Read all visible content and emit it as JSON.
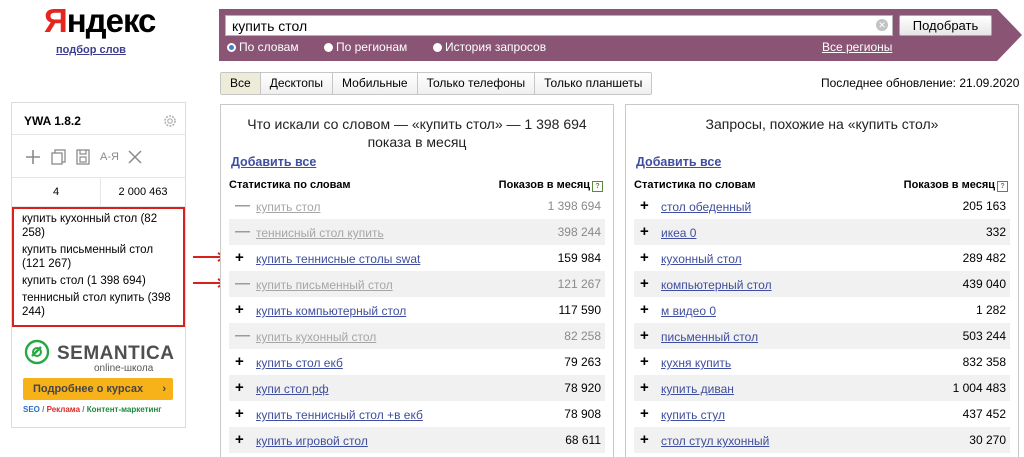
{
  "logo": {
    "text_first": "Я",
    "text_rest": "ндекс",
    "subtitle": "подбор слов"
  },
  "search": {
    "value": "купить стол",
    "submit_label": "Подобрать",
    "modes": [
      {
        "label": "По словам",
        "selected": true
      },
      {
        "label": "По регионам",
        "selected": false
      },
      {
        "label": "История запросов",
        "selected": false
      }
    ],
    "regions_link": "Все регионы"
  },
  "tabs": [
    {
      "label": "Все",
      "active": true
    },
    {
      "label": "Десктопы",
      "active": false
    },
    {
      "label": "Мобильные",
      "active": false
    },
    {
      "label": "Только телефоны",
      "active": false
    },
    {
      "label": "Только планшеты",
      "active": false
    }
  ],
  "last_update": "Последнее обновление: 21.09.2020",
  "ywa": {
    "title": "YWA 1.8.2",
    "tools": [
      "plus-icon",
      "copy-icon",
      "save-icon",
      "sort-az-icon",
      "close-icon"
    ],
    "tool_az_label": "A-Я",
    "count_words": "4",
    "count_total": "2 000 463",
    "items": [
      "купить кухонный стол (82 258)",
      "купить письменный стол (121 267)",
      "купить стол (1 398 694)",
      "теннисный стол купить (398 244)"
    ],
    "brand": {
      "name": "SEMANTICA",
      "sub": "online-школа",
      "button": "Подробнее о курсах",
      "tag_seo": "SEO",
      "sep1": " / ",
      "tag_ads": "Реклама",
      "sep2": " / ",
      "tag_content": "Контент-маркетинг"
    },
    "colors": {
      "highlight_border": "#d9201b",
      "button": "#f7b21a"
    }
  },
  "left_panel": {
    "title": "Что искали со словом — «купить стол» — 1 398 694 показа в месяц",
    "add_all": "Добавить все",
    "col_phrase": "Статистика по словам",
    "col_count": "Показов в месяц",
    "help_mark": "?",
    "rows": [
      {
        "sign": "—",
        "phrase": "купить стол",
        "count": "1 398 694",
        "added": true
      },
      {
        "sign": "—",
        "phrase": "теннисный стол купить",
        "count": "398 244",
        "added": true
      },
      {
        "sign": "+",
        "phrase": "купить теннисные столы swat",
        "count": "159 984",
        "added": false
      },
      {
        "sign": "—",
        "phrase": "купить письменный стол",
        "count": "121 267",
        "added": true
      },
      {
        "sign": "+",
        "phrase": "купить компьютерный стол",
        "count": "117 590",
        "added": false
      },
      {
        "sign": "—",
        "phrase": "купить кухонный стол",
        "count": "82 258",
        "added": true
      },
      {
        "sign": "+",
        "phrase": "купить стол екб",
        "count": "79 263",
        "added": false
      },
      {
        "sign": "+",
        "phrase": "купи стол рф",
        "count": "78 920",
        "added": false
      },
      {
        "sign": "+",
        "phrase": "купить теннисный стол +в екб",
        "count": "78 908",
        "added": false
      },
      {
        "sign": "+",
        "phrase": "купить игровой стол",
        "count": "68 611",
        "added": false
      }
    ]
  },
  "right_panel": {
    "title": "Запросы, похожие на «купить стол»",
    "add_all": "Добавить все",
    "col_phrase": "Статистика по словам",
    "col_count": "Показов в месяц",
    "help_mark": "?",
    "rows": [
      {
        "sign": "+",
        "phrase": "стол обеденный",
        "count": "205 163"
      },
      {
        "sign": "+",
        "phrase": "икеа 0",
        "count": "332"
      },
      {
        "sign": "+",
        "phrase": "кухонный стол",
        "count": "289 482"
      },
      {
        "sign": "+",
        "phrase": "компьютерный стол",
        "count": "439 040"
      },
      {
        "sign": "+",
        "phrase": "м видео 0",
        "count": "1 282"
      },
      {
        "sign": "+",
        "phrase": "письменный стол",
        "count": "503 244"
      },
      {
        "sign": "+",
        "phrase": "кухня купить",
        "count": "832 358"
      },
      {
        "sign": "+",
        "phrase": "купить диван",
        "count": "1 004 483"
      },
      {
        "sign": "+",
        "phrase": "купить стул",
        "count": "437 452"
      },
      {
        "sign": "+",
        "phrase": "стол стул кухонный",
        "count": "30 270"
      }
    ]
  },
  "colors": {
    "search_bar": "#8a5474",
    "link": "#3f4e9e",
    "logo_red": "#e52620"
  }
}
